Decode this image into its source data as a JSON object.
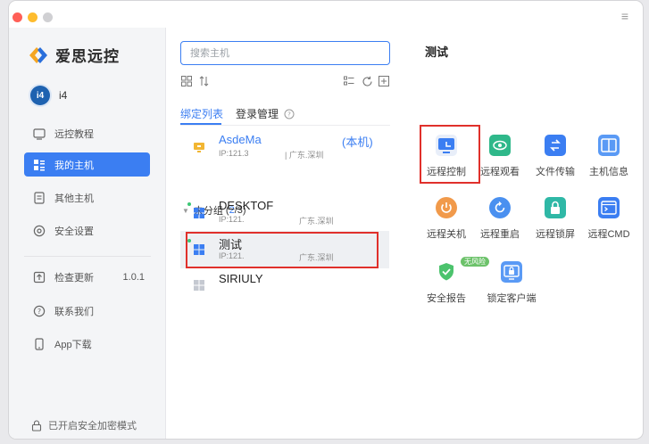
{
  "window": {
    "menu_icon": "hamburger-menu-icon"
  },
  "brand": {
    "name": "爱思远控"
  },
  "user": {
    "name": "i4",
    "avatar_text": "i4"
  },
  "sidebar": {
    "items": [
      {
        "label": "远控教程"
      },
      {
        "label": "我的主机"
      },
      {
        "label": "其他主机"
      },
      {
        "label": "安全设置"
      },
      {
        "label": "检查更新",
        "version": "1.0.1"
      },
      {
        "label": "联系我们"
      },
      {
        "label": "App下载"
      }
    ],
    "secure_mode": "已开启安全加密模式",
    "accent": "#3b7ef2"
  },
  "search": {
    "placeholder": "搜索主机",
    "value": ""
  },
  "tabs": [
    {
      "label": "绑定列表"
    },
    {
      "label": "登录管理"
    }
  ],
  "hosts": [
    {
      "name": "AsdeMa",
      "tag": "(本机)",
      "ip": "IP:121.3",
      "location": "| 广东.深圳"
    },
    {
      "name": "DESKTOF",
      "ip": "IP:121.",
      "location": "广东.深圳"
    },
    {
      "name": "测试",
      "ip": "IP:121.",
      "location": "广东.深圳"
    },
    {
      "name": "SIRIULY"
    }
  ],
  "group": {
    "label": "未分组",
    "open": "(",
    "online": "2",
    "sep": "/",
    "total": "3",
    "close": ")"
  },
  "panel": {
    "title": "测试",
    "actions": [
      {
        "label": "远程控制"
      },
      {
        "label": "远程观看"
      },
      {
        "label": "文件传输"
      },
      {
        "label": "主机信息"
      },
      {
        "label": "远程关机"
      },
      {
        "label": "远程重启"
      },
      {
        "label": "远程锁屏"
      },
      {
        "label": "远程CMD"
      },
      {
        "label": "安全报告",
        "badge": "无风险"
      },
      {
        "label": "锁定客户端"
      }
    ]
  }
}
